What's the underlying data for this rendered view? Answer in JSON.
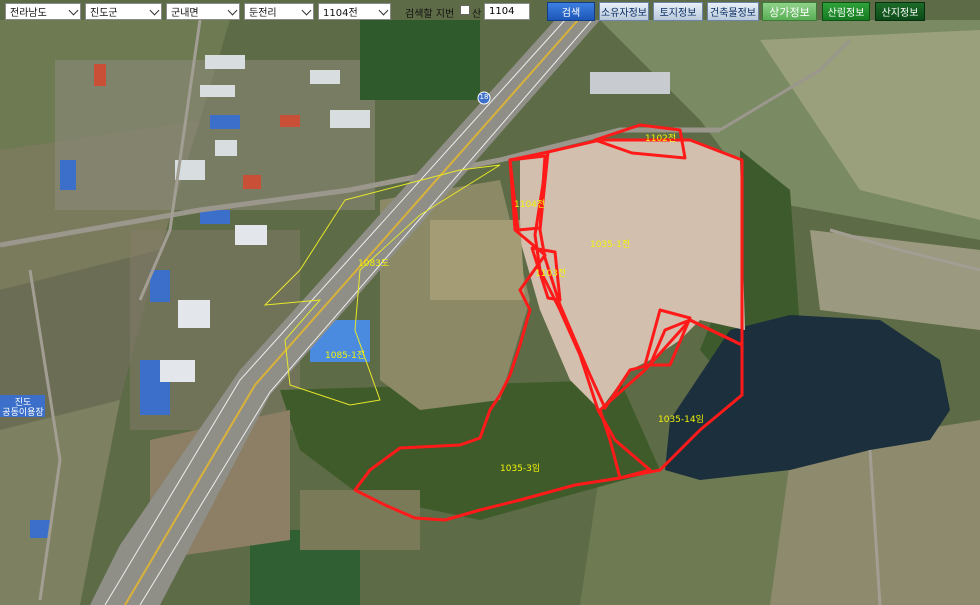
{
  "toolbar": {
    "province": "전라남도",
    "county": "진도군",
    "town": "군내면",
    "village": "둔전리",
    "lot": "1104전",
    "search_label": "검색할 지번",
    "mountain_label": "산",
    "lot_input": "1104",
    "buttons": {
      "search": "검색",
      "owner_info": "소유자정보",
      "land_info": "토지정보",
      "building_info": "건축물정보",
      "commercial_info": "상가정보",
      "forest_info": "산림정보",
      "mountain_info": "산지정보"
    }
  },
  "map": {
    "parcel_labels": {
      "lot_1102": "1102전",
      "lot_1104": "1104전",
      "lot_1035_main": "1035-1전",
      "lot_1103": "1103전",
      "lot_1083": "1083도",
      "lot_1085": "1085-1전",
      "lot_1035_14": "1035-14임",
      "lot_1035_3": "1035-3임"
    },
    "highway_shield": "18",
    "place_label": "진도\n공동이용장",
    "colors": {
      "selected_parcel_outline": "#ff1a1a",
      "boundary_outline": "#e8e82a",
      "parcel_text": "#f2f20a"
    }
  }
}
